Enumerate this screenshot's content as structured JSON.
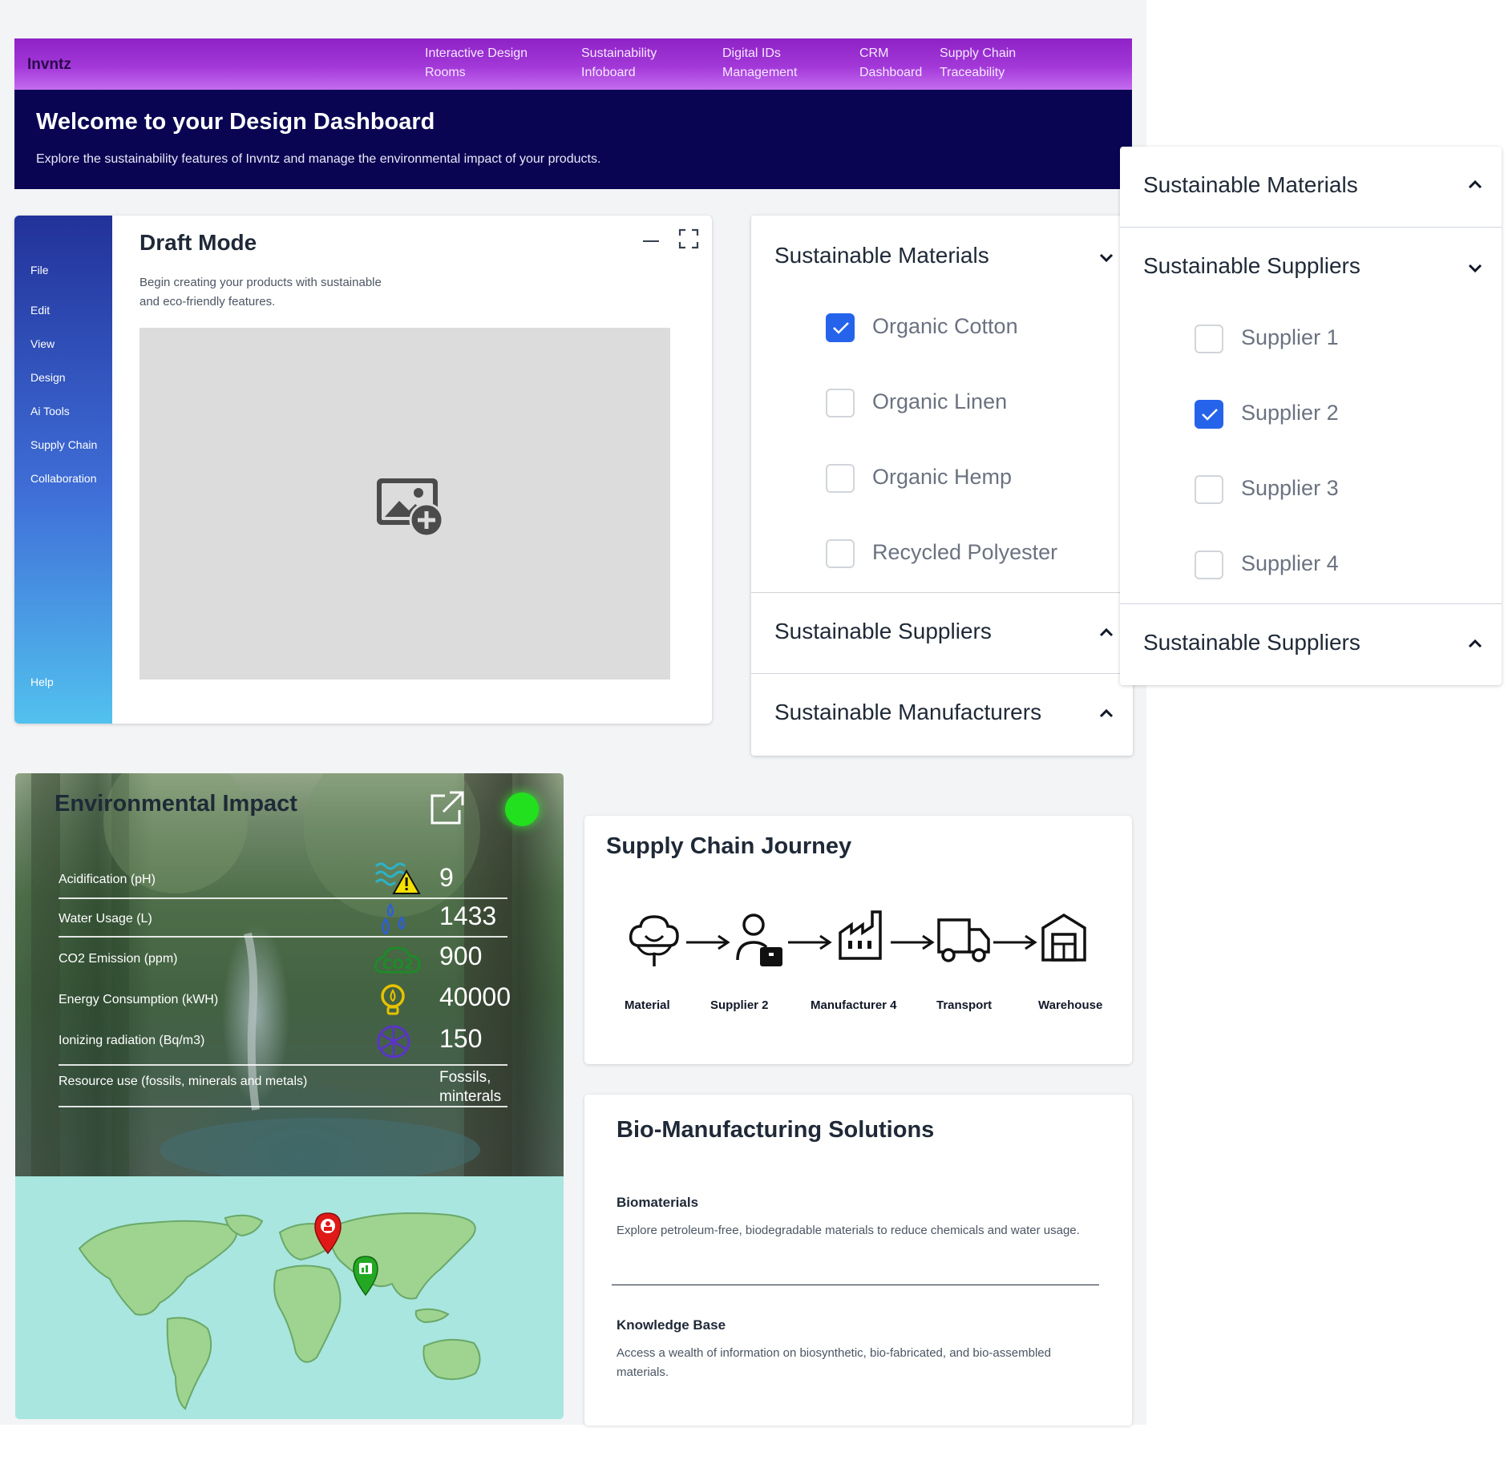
{
  "nav": {
    "brand": "Invntz",
    "links": [
      {
        "line1": "Interactive Design",
        "line2": "Rooms"
      },
      {
        "line1": "Sustainability",
        "line2": "Infoboard"
      },
      {
        "line1": "Digital IDs",
        "line2": "Management"
      },
      {
        "line1": "CRM",
        "line2": "Dashboard"
      },
      {
        "line1": "Supply Chain",
        "line2": "Traceability"
      }
    ]
  },
  "hero": {
    "title": "Welcome to your Design Dashboard",
    "subtitle": "Explore the sustainability features of Invntz and manage the environmental impact of your products."
  },
  "draft": {
    "menu": [
      "File",
      "Edit",
      "View",
      "Design",
      "Ai Tools",
      "Supply Chain",
      "Collaboration",
      "Help"
    ],
    "title": "Draft Mode",
    "description": "Begin creating your products with sustainable and eco-friendly features."
  },
  "accordion_main": {
    "sections": [
      {
        "title": "Sustainable Materials",
        "expanded": true
      },
      {
        "title": "Sustainable Suppliers",
        "expanded": false
      },
      {
        "title": "Sustainable Manufacturers",
        "expanded": false
      }
    ],
    "materials": [
      {
        "label": "Organic Cotton",
        "checked": true
      },
      {
        "label": "Organic Linen",
        "checked": false
      },
      {
        "label": "Organic Hemp",
        "checked": false
      },
      {
        "label": "Recycled Polyester",
        "checked": false
      }
    ]
  },
  "accordion_overlay": {
    "sections": [
      {
        "title": "Sustainable Materials",
        "expanded": false
      },
      {
        "title": "Sustainable Suppliers",
        "expanded": true
      },
      {
        "title": "Sustainable Suppliers",
        "expanded": false
      }
    ],
    "suppliers": [
      {
        "label": "Supplier 1",
        "checked": false
      },
      {
        "label": "Supplier 2",
        "checked": true
      },
      {
        "label": "Supplier 3",
        "checked": false
      },
      {
        "label": "Supplier 4",
        "checked": false
      }
    ]
  },
  "environment": {
    "title": "Environmental Impact",
    "status_color": "#22e01e",
    "metrics": [
      {
        "label": "Acidification (pH)",
        "value": "9",
        "icon": "water-warning-icon"
      },
      {
        "label": "Water Usage (L)",
        "value": "1433",
        "icon": "water-drops-icon"
      },
      {
        "label": "CO2 Emission (ppm)",
        "value": "900",
        "icon": "co2-cloud-icon"
      },
      {
        "label": "Energy Consumption (kWH)",
        "value": "40000",
        "icon": "lightbulb-icon"
      },
      {
        "label": "Ionizing radiation (Bq/m3)",
        "value": "150",
        "icon": "radiation-icon"
      },
      {
        "label": "Resource use (fossils, minerals and metals)",
        "value_line1": "Fossils,",
        "value_line2": "minterals"
      }
    ]
  },
  "journey": {
    "title": "Supply Chain Journey",
    "steps": [
      {
        "label": "Material",
        "icon": "cotton-icon"
      },
      {
        "label": "Supplier 2",
        "icon": "supplier-icon"
      },
      {
        "label": "Manufacturer 4",
        "icon": "factory-icon"
      },
      {
        "label": "Transport",
        "icon": "truck-icon"
      },
      {
        "label": "Warehouse",
        "icon": "warehouse-icon"
      }
    ]
  },
  "bio": {
    "title": "Bio-Manufacturing Solutions",
    "items": [
      {
        "heading": "Biomaterials",
        "text": "Explore petroleum-free, biodegradable materials to reduce chemicals and water usage."
      },
      {
        "heading": "Knowledge Base",
        "text": "Access a wealth of information on biosynthetic, bio-fabricated, and bio-assembled materials."
      }
    ]
  },
  "colors": {
    "nav_gradient_start": "#8e22c6",
    "hero_bg": "#0a0553",
    "checkbox_checked": "#2563eb",
    "map_bg": "#a9e6df"
  }
}
